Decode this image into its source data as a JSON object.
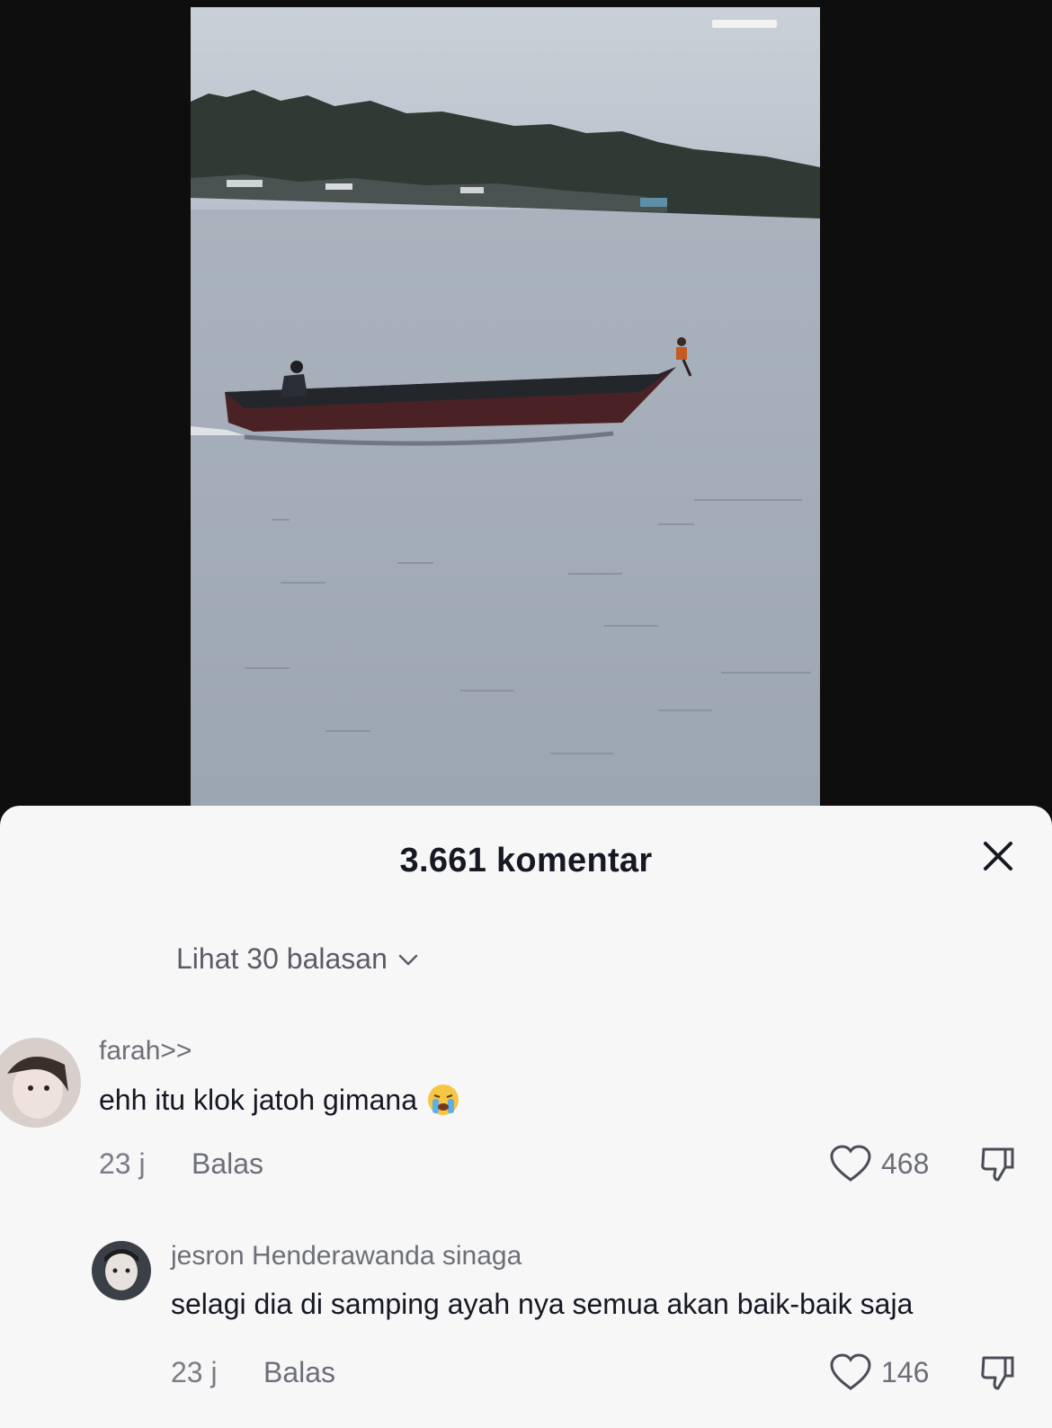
{
  "sheet": {
    "title": "3.661 komentar",
    "view_replies_label": "Lihat 30 balasan"
  },
  "comments": [
    {
      "username": "farah>>",
      "text": "ehh itu klok jatoh gimana",
      "emoji": "crying-face",
      "time": "23 j",
      "reply_label": "Balas",
      "likes": "468"
    },
    {
      "username": "jesron Henderawanda sinaga",
      "text": "selagi dia di samping ayah nya semua akan baik-baik saja",
      "time": "23 j",
      "reply_label": "Balas",
      "likes": "146"
    }
  ],
  "icons": {
    "close": "close-icon",
    "chevron": "chevron-down-icon",
    "like": "heart-icon",
    "dislike": "thumbs-down-icon"
  }
}
